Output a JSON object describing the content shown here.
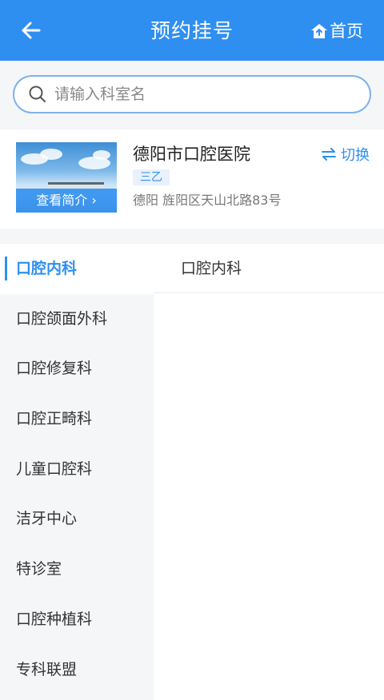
{
  "header": {
    "title": "预约挂号",
    "home_label": "首页"
  },
  "search": {
    "placeholder": "请输入科室名"
  },
  "hospital": {
    "name": "德阳市口腔医院",
    "level": "三乙",
    "address": "德阳 旌阳区天山北路83号",
    "intro_label": "查看简介 ›",
    "switch_label": "切换"
  },
  "departments": [
    "口腔内科",
    "口腔颌面外科",
    "口腔修复科",
    "口腔正畸科",
    "儿童口腔科",
    "洁牙中心",
    "特诊室",
    "口腔种植科",
    "专科联盟"
  ],
  "sub_departments": [
    "口腔内科"
  ],
  "colors": {
    "accent": "#2f8ff0",
    "background": "#f5f6f8"
  }
}
